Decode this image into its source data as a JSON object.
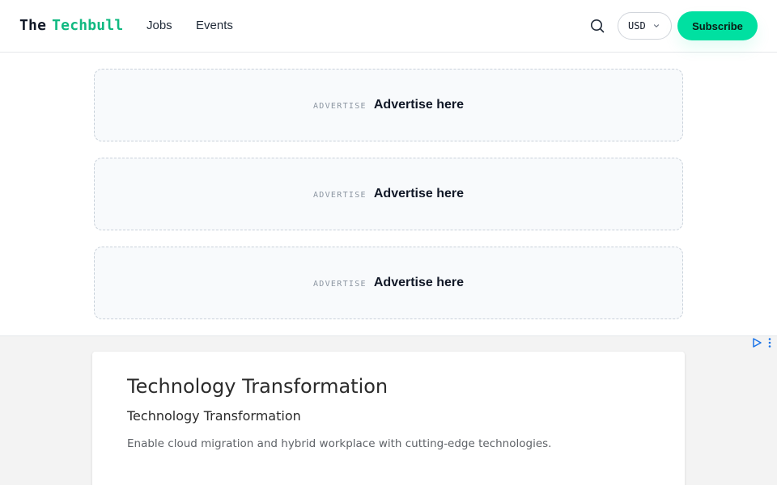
{
  "header": {
    "logo": {
      "part1": "The",
      "part2": "Techbull"
    },
    "nav": [
      {
        "label": "Jobs"
      },
      {
        "label": "Events"
      }
    ],
    "search_icon": "search-icon",
    "currency": {
      "value": "USD",
      "icon": "chevron-down-icon"
    },
    "subscribe_label": "Subscribe"
  },
  "advertise_slots": [
    {
      "tag": "ADVERTISE",
      "label": "Advertise here"
    },
    {
      "tag": "ADVERTISE",
      "label": "Advertise here"
    },
    {
      "tag": "ADVERTISE",
      "label": "Advertise here"
    }
  ],
  "sponsored_ad": {
    "title": "Technology Transformation",
    "subtitle": "Technology Transformation",
    "description": "Enable cloud migration and hybrid workplace with cutting-edge technologies.",
    "adchoices_icon": "adchoices-icon",
    "menu_icon": "kebab-menu-icon"
  },
  "colors": {
    "accent": "#00e0a1",
    "logo_accent": "#10b981",
    "text": "#111827",
    "ad_icon": "#1a73e8"
  }
}
